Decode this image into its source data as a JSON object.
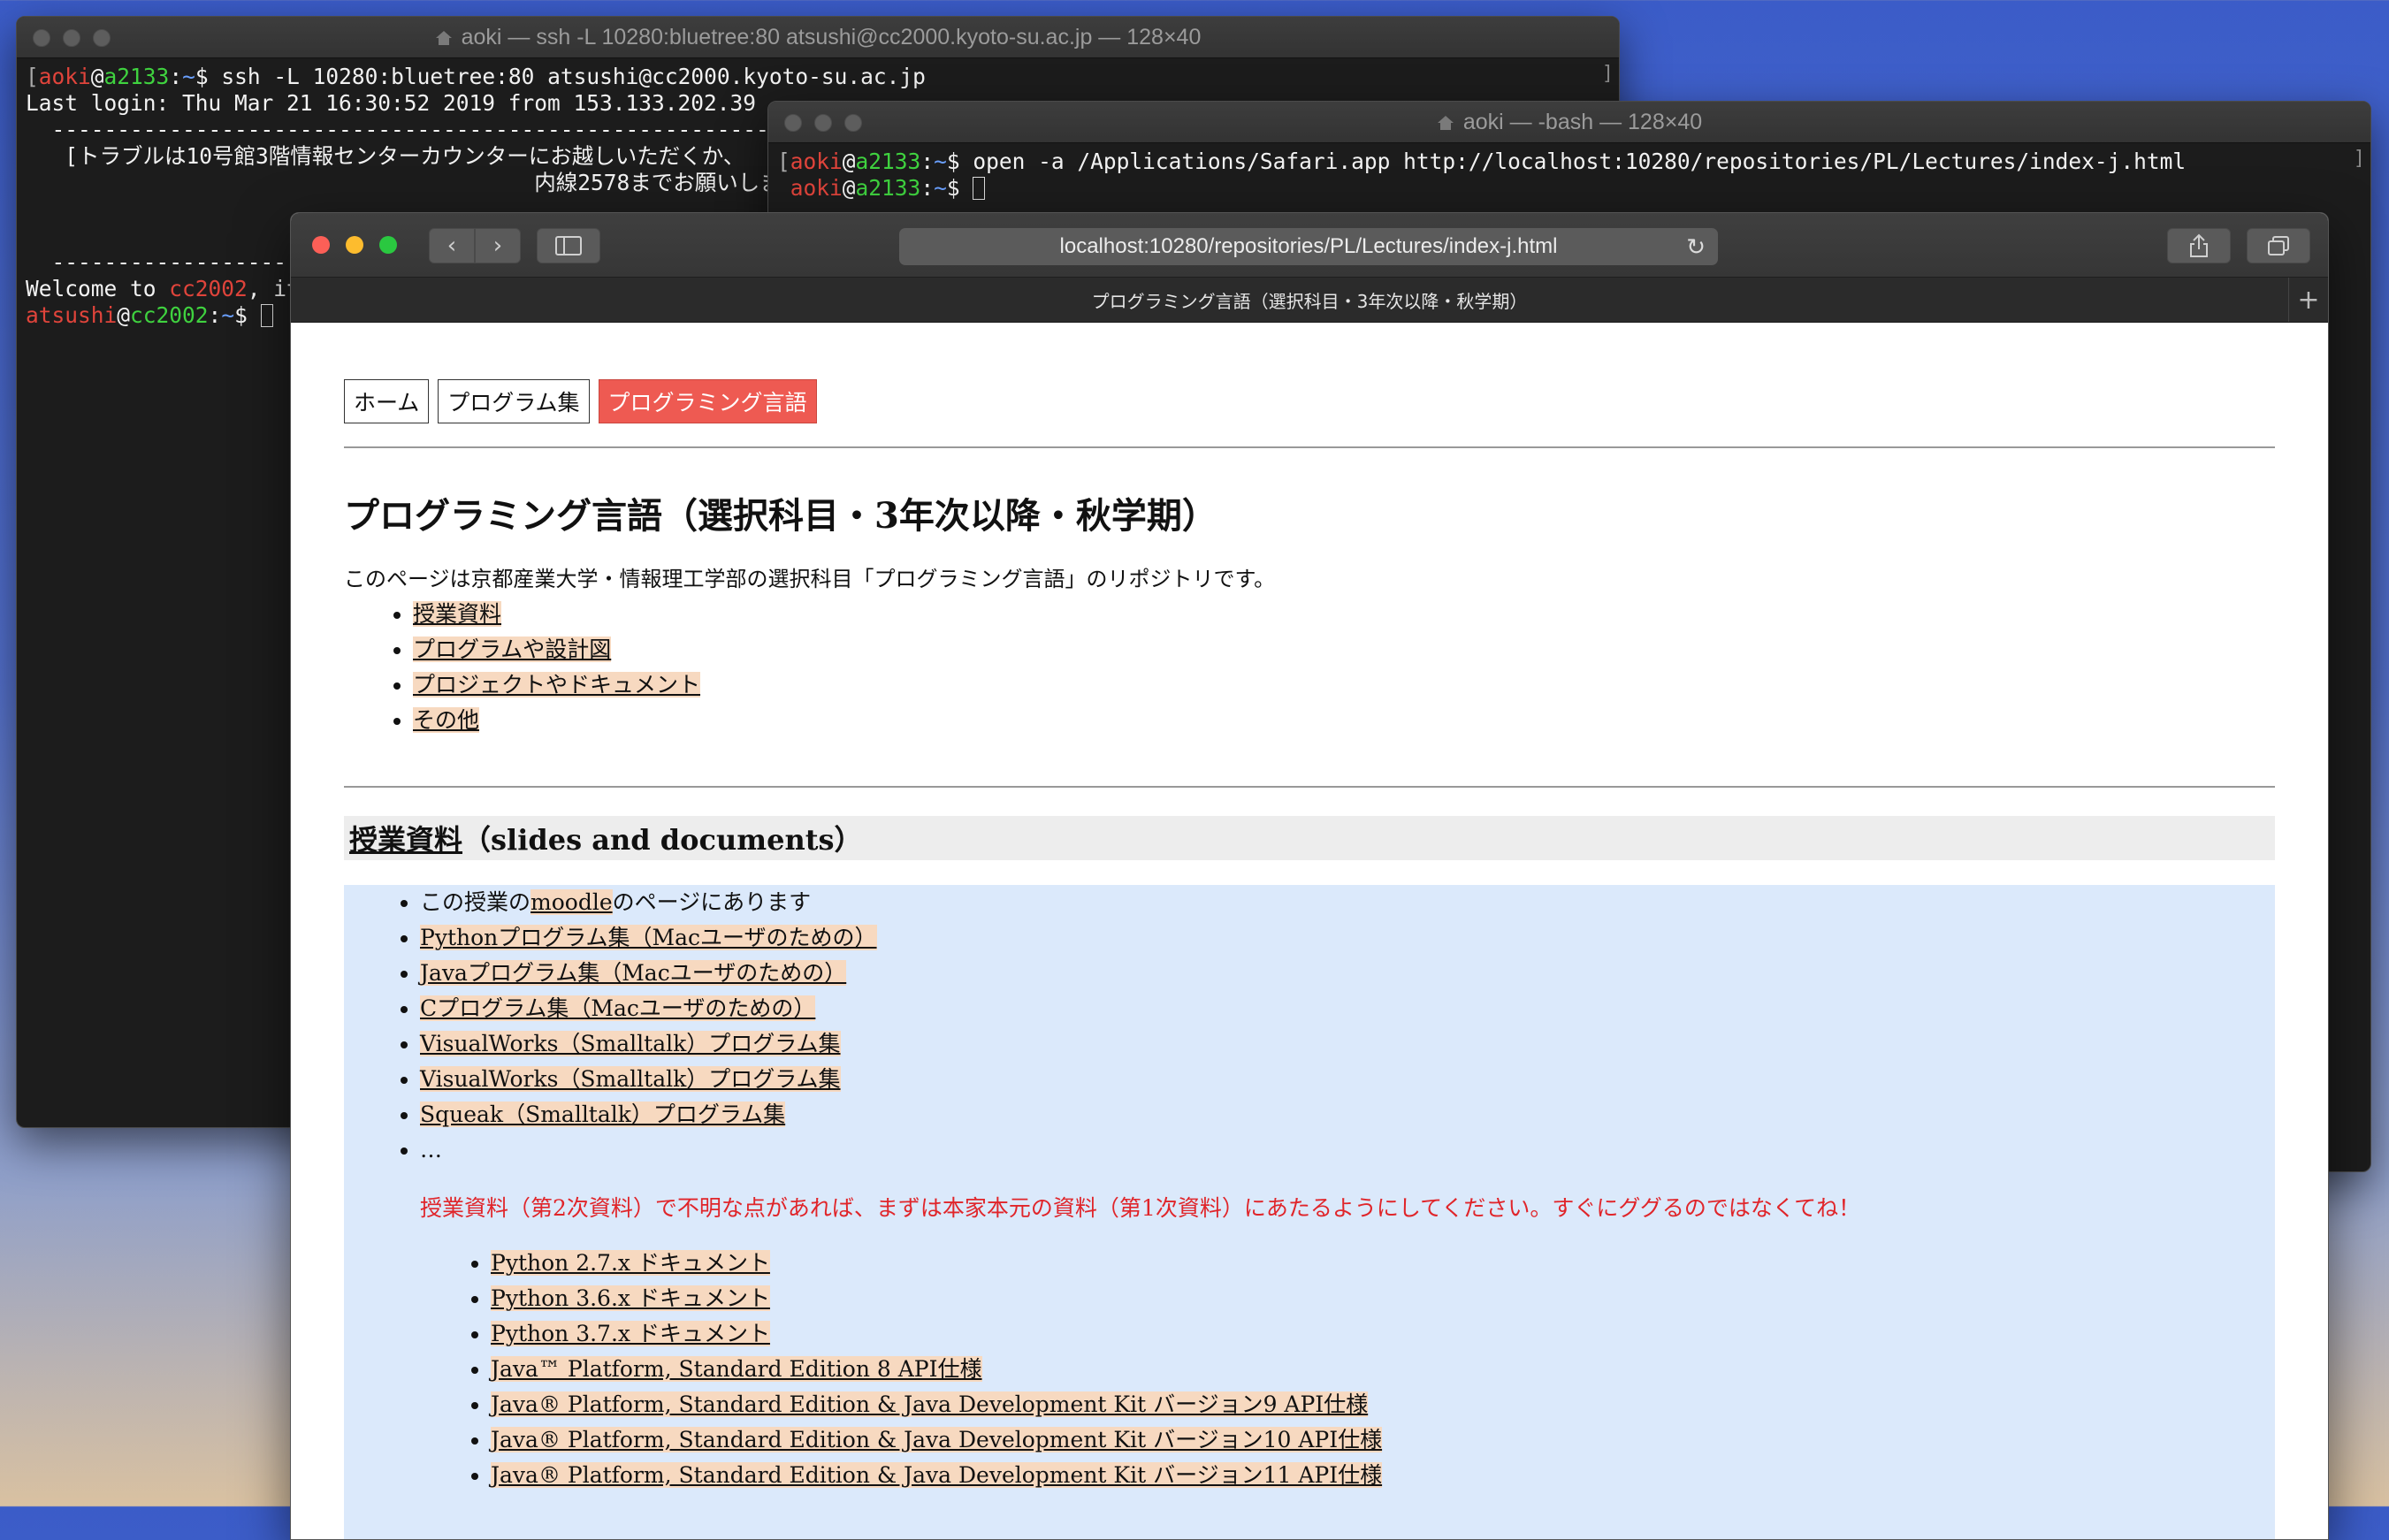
{
  "terminal1": {
    "title": "aoki — ssh -L 10280:bluetree:80 atsushi@cc2000.kyoto-su.ac.jp — 128×40",
    "prompt_user": "aoki",
    "prompt_host": "a2133",
    "command": "ssh -L 10280:bluetree:80 atsushi@cc2000.kyoto-su.ac.jp",
    "last_login": "Last login: Thu Mar 21 16:30:52 2019 from 153.133.202.39",
    "dashes": "----------------------------------------------------------",
    "trouble_line1": "[トラブルは10号館3階情報センターカウンターにお越しいただくか、",
    "trouble_line2": "内線2578までお願いしま",
    "dashes2": "------------------",
    "welcome_prefix": "Welcome to ",
    "welcome_host": "cc2002",
    "welcome_suffix": ", it",
    "prompt2_user": "atsushi",
    "prompt2_host": "cc2002"
  },
  "terminal2": {
    "title": "aoki — -bash — 128×40",
    "prompt_user": "aoki",
    "prompt_host": "a2133",
    "command": "open -a /Applications/Safari.app http://localhost:10280/repositories/PL/Lectures/index-j.html"
  },
  "safari": {
    "url": "localhost:10280/repositories/PL/Lectures/index-j.html",
    "tab_title": "プログラミング言語（選択科目・3年次以降・秋学期）"
  },
  "page": {
    "nav": [
      "ホーム",
      "プログラム集",
      "プログラミング言語"
    ],
    "title": "プログラミング言語（選択科目・3年次以降・秋学期）",
    "intro": "このページは京都産業大学・情報理工学部の選択科目「プログラミング言語」のリポジトリです。",
    "toc": [
      "授業資料",
      "プログラムや設計図",
      "プロジェクトやドキュメント",
      "その他"
    ],
    "section_link": "授業資料",
    "section_rest": "（slides and documents）",
    "moodle_pre": "この授業の",
    "moodle_link": "moodle",
    "moodle_post": "のページにあります",
    "resources": [
      "Pythonプログラム集（Macユーザのための）",
      "Javaプログラム集（Macユーザのための）",
      "Cプログラム集（Macユーザのための）",
      "VisualWorks（Smalltalk）プログラム集",
      "VisualWorks（Smalltalk）プログラム集",
      "Squeak（Smalltalk）プログラム集"
    ],
    "ellipsis": "…",
    "notice": "授業資料（第2次資料）で不明な点があれば、まずは本家本元の資料（第1次資料）にあたるようにしてください。すぐにググるのではなくてね！",
    "docs": [
      "Python 2.7.x ドキュメント",
      "Python 3.6.x ドキュメント",
      "Python 3.7.x ドキュメント",
      "Java™ Platform, Standard Edition 8 API仕様",
      "Java® Platform, Standard Edition & Java Development Kit バージョン9 API仕様",
      "Java® Platform, Standard Edition & Java Development Kit バージョン10 API仕様",
      "Java® Platform, Standard Edition & Java Development Kit バージョン11 API仕様"
    ]
  }
}
